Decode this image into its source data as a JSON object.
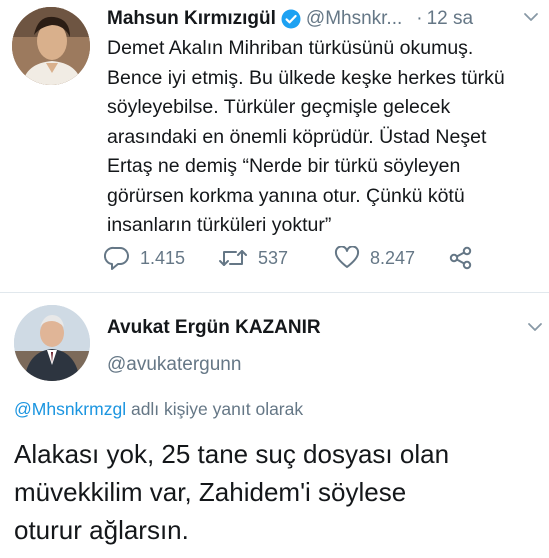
{
  "tweet1": {
    "author_name": "Mahsun Kırmızıgül",
    "handle": "@Mhsnkr...",
    "separator": "·",
    "time": "12 sa",
    "verified": true,
    "body_lines": [
      "Demet Akalın Mihriban türküsünü okumuş.",
      "Bence iyi etmiş. Bu ülkede keşke herkes türkü",
      "söyleyebilse.  Türküler geçmişle gelecek",
      "arasındaki en önemli köprüdür. Üstad Neşet",
      "Ertaş ne demiş  “Nerde bir türkü söyleyen",
      "görürsen korkma yanına otur. Çünkü kötü",
      "insanların türküleri yoktur”"
    ],
    "actions": {
      "reply_count": "1.415",
      "retweet_count": "537",
      "like_count": "8.247"
    }
  },
  "tweet2": {
    "author_name": "Avukat Ergün KAZANIR",
    "handle": "@avukatergunn",
    "replying_mention": "@Mhsnkrmzgl",
    "replying_text": " adlı kişiye yanıt olarak",
    "body_lines": [
      "Alakası yok, 25 tane suç dosyası olan",
      "müvekkilim var, Zahidem'i söylese",
      "oturur ağlarsın."
    ]
  },
  "icons": {
    "reply": "reply-icon",
    "retweet": "retweet-icon",
    "like": "heart-icon",
    "share": "share-icon",
    "menu": "chevron-down-icon",
    "verified": "verified-badge-icon"
  },
  "colors": {
    "text": "#14171a",
    "secondary": "#657786",
    "link": "#1b95e0",
    "verified": "#1da1f2",
    "divider": "#e1e8ed"
  }
}
